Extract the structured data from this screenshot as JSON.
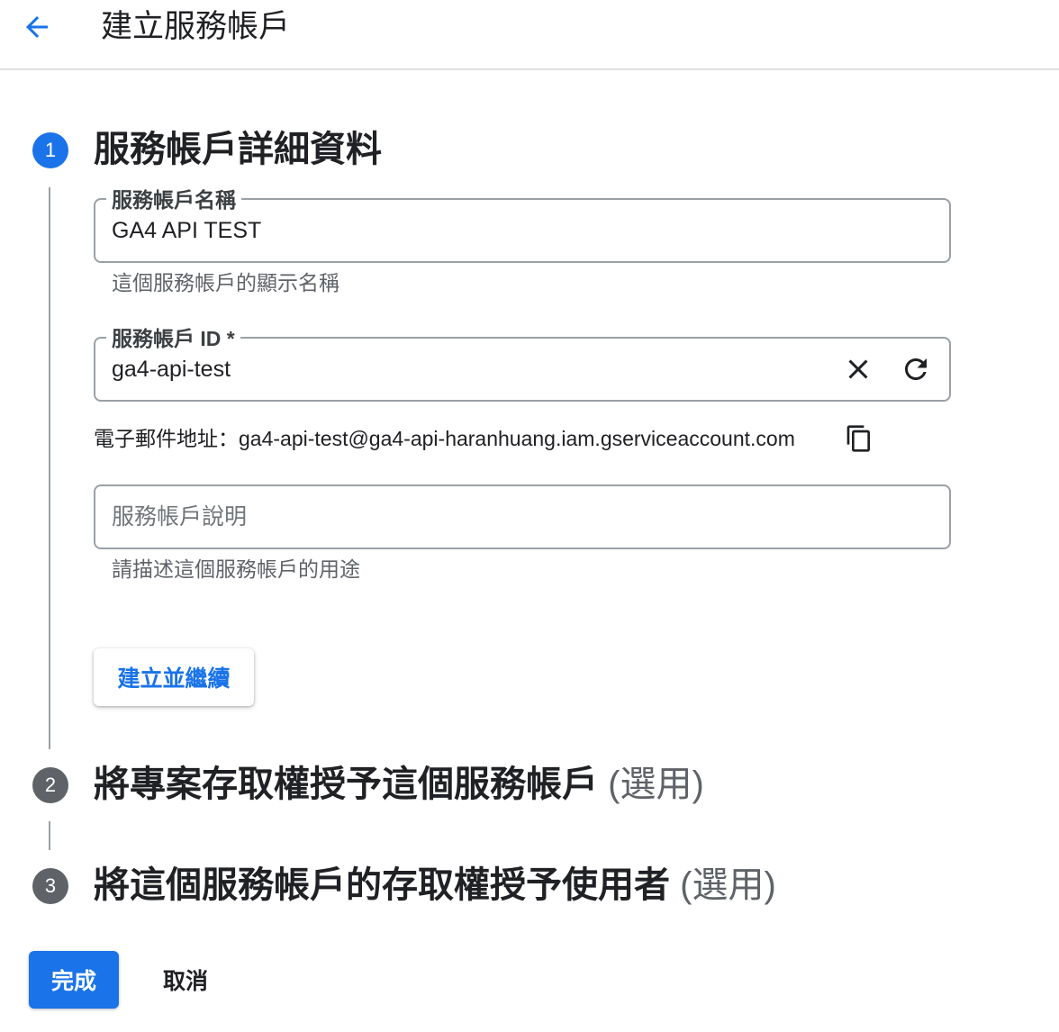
{
  "header": {
    "title": "建立服務帳戶"
  },
  "steps": [
    {
      "number": "1",
      "title": "服務帳戶詳細資料",
      "optional": ""
    },
    {
      "number": "2",
      "title": "將專案存取權授予這個服務帳戶",
      "optional": "(選用)"
    },
    {
      "number": "3",
      "title": "將這個服務帳戶的存取權授予使用者",
      "optional": "(選用)"
    }
  ],
  "form": {
    "name_field": {
      "label": "服務帳戶名稱",
      "value": "GA4 API TEST",
      "helper": "這個服務帳戶的顯示名稱"
    },
    "id_field": {
      "label": "服務帳戶 ID *",
      "value": "ga4-api-test"
    },
    "email": {
      "label": "電子郵件地址：",
      "value": "ga4-api-test@ga4-api-haranhuang.iam.gserviceaccount.com"
    },
    "description_field": {
      "placeholder": "服務帳戶說明",
      "helper": "請描述這個服務帳戶的用途"
    },
    "create_continue_label": "建立並繼續"
  },
  "footer": {
    "done_label": "完成",
    "cancel_label": "取消"
  },
  "colors": {
    "accent": "#1a73e8",
    "step_inactive": "#5f6368",
    "border": "#9aa0a6"
  },
  "icons": {
    "back": "arrow-left-icon",
    "clear": "close-icon",
    "refresh": "refresh-icon",
    "copy": "copy-icon"
  }
}
